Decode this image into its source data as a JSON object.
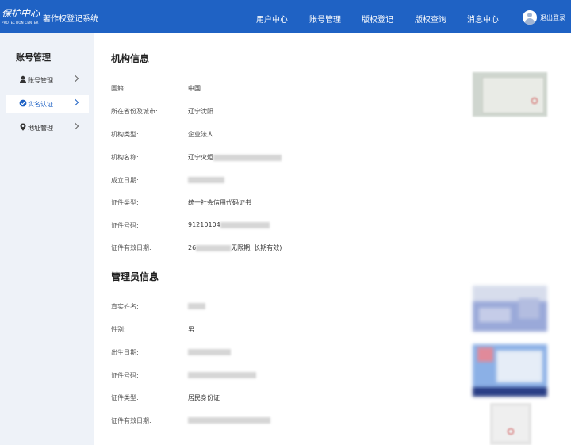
{
  "header": {
    "logo_cn": "保护中心",
    "logo_en": "PROTECTION CENTER",
    "system_title": "著作权登记系统",
    "nav": [
      "用户中心",
      "账号管理",
      "版权登记",
      "版权查询",
      "消息中心"
    ],
    "logout_label": "退出登录"
  },
  "sidebar": {
    "title": "账号管理",
    "items": [
      {
        "label": "账号管理",
        "icon": "person-icon"
      },
      {
        "label": "实名认证",
        "icon": "verified-icon",
        "active": true
      },
      {
        "label": "地址管理",
        "icon": "location-pin-icon"
      }
    ]
  },
  "org_section": {
    "title": "机构信息",
    "fields": [
      {
        "label": "国籍:",
        "value": "中国"
      },
      {
        "label": "所在省份及城市:",
        "value": "辽宁沈阳"
      },
      {
        "label": "机构类型:",
        "value": "企业法人"
      },
      {
        "label": "机构名称:",
        "value": "辽宁火炬"
      },
      {
        "label": "成立日期:",
        "value": ""
      },
      {
        "label": "证件类型:",
        "value": "统一社会信用代码证书"
      },
      {
        "label": "证件号码:",
        "value": "91210104"
      },
      {
        "label": "证件有效日期:",
        "value_prefix": "26",
        "value_suffix": "无限期, 长期有效)"
      }
    ]
  },
  "admin_section": {
    "title": "管理员信息",
    "fields": [
      {
        "label": "真实姓名:",
        "value": ""
      },
      {
        "label": "性别:",
        "value": "男"
      },
      {
        "label": "出生日期:",
        "value": ""
      },
      {
        "label": "证件号码:",
        "value": ""
      },
      {
        "label": "证件类型:",
        "value": "居民身份证"
      },
      {
        "label": "证件有效日期:",
        "value": ""
      }
    ]
  },
  "colors": {
    "primary": "#1f62c4",
    "sidebar_bg": "#eef2f8"
  }
}
